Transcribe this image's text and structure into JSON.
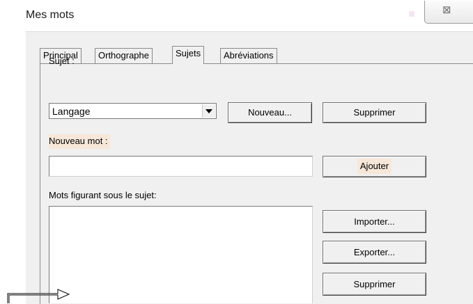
{
  "window": {
    "title": "Mes mots",
    "close_glyph": "⊠"
  },
  "tabs": [
    {
      "label": "Principal",
      "active": false
    },
    {
      "label": "Orthographe",
      "active": false
    },
    {
      "label": "Sujets",
      "active": true
    },
    {
      "label": "Abréviations",
      "active": false
    }
  ],
  "subject": {
    "label": "Sujet :",
    "selected": "Langage",
    "new_button": "Nouveau...",
    "delete_button": "Supprimer"
  },
  "new_word": {
    "label": "Nouveau mot :",
    "value": "",
    "add_button": "Ajouter"
  },
  "words_list": {
    "label": "Mots figurant sous le sujet:",
    "import_button": "Importer...",
    "export_button": "Exporter...",
    "delete_button": "Supprimer"
  },
  "colors": {
    "highlight": "#f6e7d8",
    "dialog_bg": "#f0f0f0"
  }
}
